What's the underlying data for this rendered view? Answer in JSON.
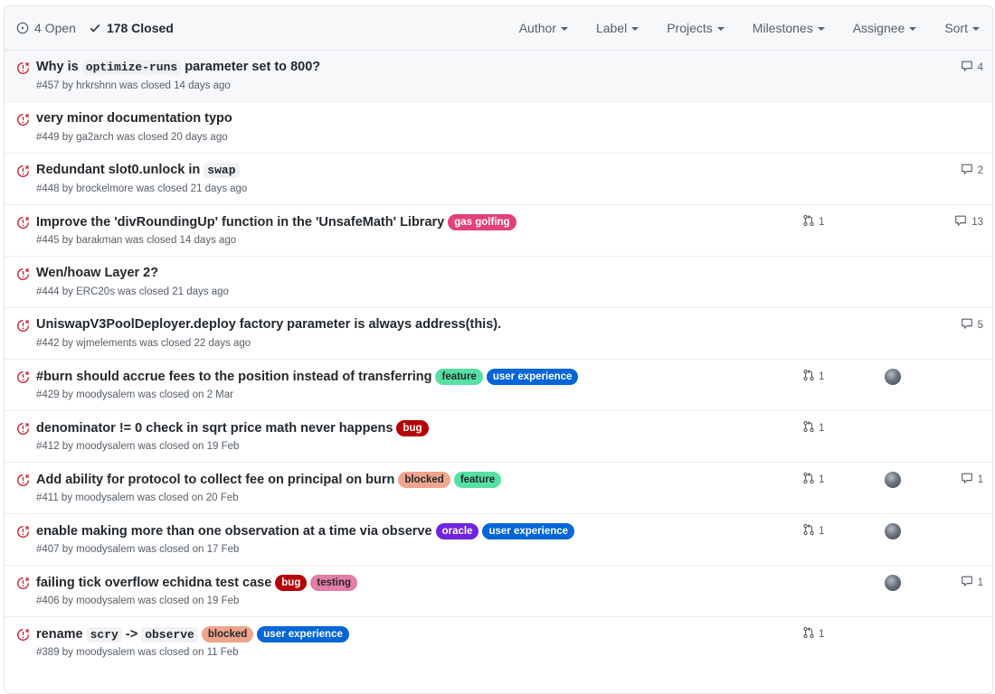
{
  "header": {
    "open_label": "4 Open",
    "closed_label": "178 Closed",
    "filters": [
      "Author",
      "Label",
      "Projects",
      "Milestones",
      "Assignee",
      "Sort"
    ]
  },
  "colors": {
    "closed_icon": "#cb2431",
    "gas_golfing": "#e4417a",
    "feature": "#56e0a4",
    "user_experience": "#0366d6",
    "bug": "#b60205",
    "blocked": "#eea58b",
    "oracle": "#6f24e0",
    "testing": "#e47ea4"
  },
  "issues": [
    {
      "title_parts": [
        {
          "text": "Why is "
        },
        {
          "text": "optimize-runs",
          "code": true
        },
        {
          "text": " parameter set to 800?"
        }
      ],
      "meta": "#457 by hrkrshnn was closed 14 days ago",
      "labels": [],
      "pr": "",
      "avatar": false,
      "comments": "4",
      "highlight": true
    },
    {
      "title_parts": [
        {
          "text": "very minor documentation typo"
        }
      ],
      "meta": "#449 by ga2arch was closed 20 days ago",
      "labels": [],
      "pr": "",
      "avatar": false,
      "comments": ""
    },
    {
      "title_parts": [
        {
          "text": "Redundant slot0.unlock in "
        },
        {
          "text": "swap",
          "code": true
        }
      ],
      "meta": "#448 by brockelmore was closed 21 days ago",
      "labels": [],
      "pr": "",
      "avatar": false,
      "comments": "2"
    },
    {
      "title_parts": [
        {
          "text": "Improve the 'divRoundingUp' function in the 'UnsafeMath' Library"
        }
      ],
      "meta": "#445 by barakman was closed 14 days ago",
      "labels": [
        {
          "name": "gas golfing",
          "bg": "#e4417a",
          "fg": "#ffffff"
        }
      ],
      "pr": "1",
      "avatar": false,
      "comments": "13"
    },
    {
      "title_parts": [
        {
          "text": "Wen/hoaw Layer 2?"
        }
      ],
      "meta": "#444 by ERC20s was closed 21 days ago",
      "labels": [],
      "pr": "",
      "avatar": false,
      "comments": ""
    },
    {
      "title_parts": [
        {
          "text": "UniswapV3PoolDeployer.deploy factory parameter is always address(this)."
        }
      ],
      "meta": "#442 by wjmelements was closed 22 days ago",
      "labels": [],
      "pr": "",
      "avatar": false,
      "comments": "5"
    },
    {
      "title_parts": [
        {
          "text": "#burn should accrue fees to the position instead of transferring"
        }
      ],
      "meta": "#429 by moodysalem was closed on 2 Mar",
      "labels": [
        {
          "name": "feature",
          "bg": "#56e0a4",
          "fg": "#24292e"
        },
        {
          "name": "user experience",
          "bg": "#0366d6",
          "fg": "#ffffff"
        }
      ],
      "pr": "1",
      "avatar": true,
      "comments": ""
    },
    {
      "title_parts": [
        {
          "text": "denominator != 0 check in sqrt price math never happens"
        }
      ],
      "meta": "#412 by moodysalem was closed on 19 Feb",
      "labels": [
        {
          "name": "bug",
          "bg": "#b60205",
          "fg": "#ffffff"
        }
      ],
      "pr": "1",
      "avatar": false,
      "comments": ""
    },
    {
      "title_parts": [
        {
          "text": "Add ability for protocol to collect fee on principal on burn"
        }
      ],
      "meta": "#411 by moodysalem was closed on 20 Feb",
      "labels": [
        {
          "name": "blocked",
          "bg": "#eea58b",
          "fg": "#24292e"
        },
        {
          "name": "feature",
          "bg": "#56e0a4",
          "fg": "#24292e"
        }
      ],
      "pr": "1",
      "avatar": true,
      "comments": "1"
    },
    {
      "title_parts": [
        {
          "text": "enable making more than one observation at a time via observe"
        }
      ],
      "meta": "#407 by moodysalem was closed on 17 Feb",
      "labels": [
        {
          "name": "oracle",
          "bg": "#6f24e0",
          "fg": "#ffffff"
        },
        {
          "name": "user experience",
          "bg": "#0366d6",
          "fg": "#ffffff"
        }
      ],
      "pr": "1",
      "avatar": true,
      "comments": ""
    },
    {
      "title_parts": [
        {
          "text": "failing tick overflow echidna test case"
        }
      ],
      "meta": "#406 by moodysalem was closed on 19 Feb",
      "labels": [
        {
          "name": "bug",
          "bg": "#b60205",
          "fg": "#ffffff"
        },
        {
          "name": "testing",
          "bg": "#e47ea4",
          "fg": "#24292e"
        }
      ],
      "pr": "",
      "avatar": true,
      "comments": "1"
    },
    {
      "title_parts": [
        {
          "text": "rename "
        },
        {
          "text": "scry",
          "code": true
        },
        {
          "text": " -> "
        },
        {
          "text": "observe",
          "code": true
        }
      ],
      "meta": "#389 by moodysalem was closed on 11 Feb",
      "labels": [
        {
          "name": "blocked",
          "bg": "#eea58b",
          "fg": "#24292e"
        },
        {
          "name": "user experience",
          "bg": "#0366d6",
          "fg": "#ffffff"
        }
      ],
      "pr": "1",
      "avatar": false,
      "comments": ""
    }
  ]
}
